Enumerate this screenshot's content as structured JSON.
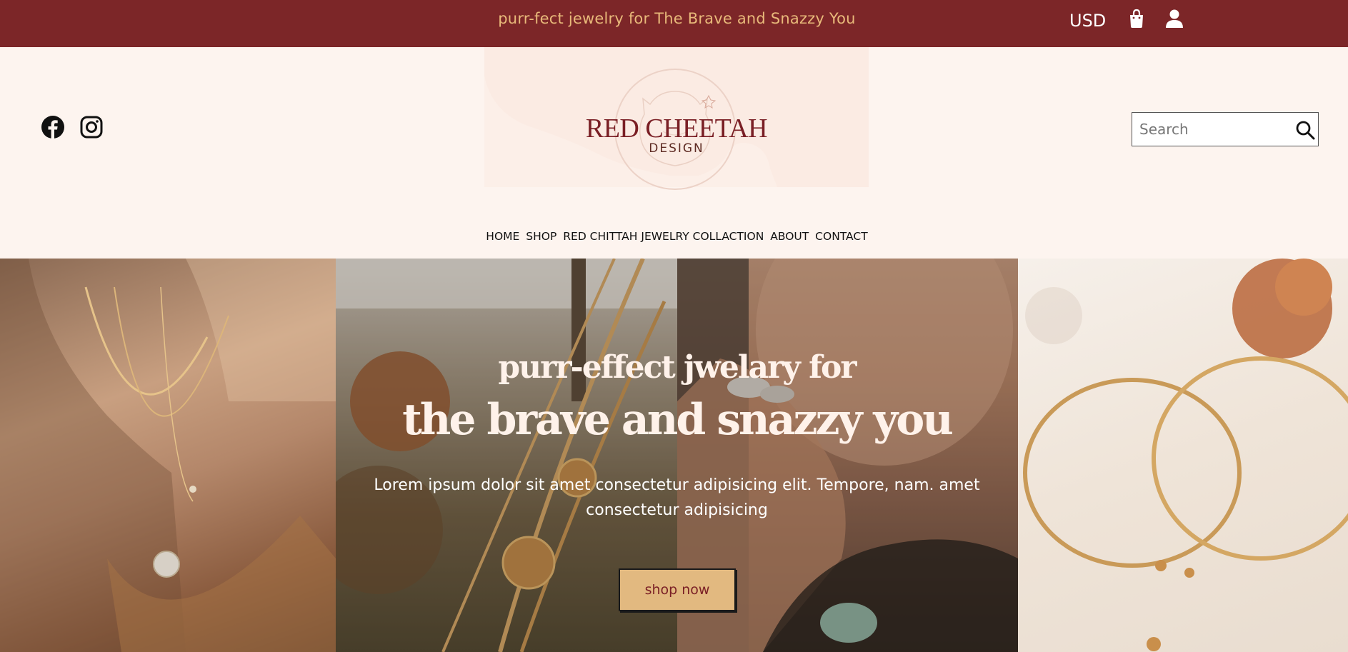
{
  "topbar": {
    "promo": "purr-fect jewelry for The Brave and Snazzy You",
    "currency": "USD",
    "bag_icon": "shopping-bag-icon",
    "user_icon": "user-icon"
  },
  "header": {
    "logo_title": "RED CHEETAH",
    "logo_subtitle": "DESIGN",
    "social": [
      "facebook-icon",
      "instagram-icon"
    ],
    "search": {
      "placeholder": "Search",
      "icon": "search-icon"
    }
  },
  "nav": {
    "items": [
      {
        "label": "HOME"
      },
      {
        "label": "SHOP"
      },
      {
        "label": "RED CHITTAH JEWELRY COLLACTION"
      },
      {
        "label": "ABOUT"
      },
      {
        "label": "CONTACT"
      }
    ]
  },
  "hero": {
    "heading_line1": "purr-effect jwelary for",
    "heading_line2": "the brave and snazzy you",
    "body": "Lorem ipsum dolor sit amet consectetur adipisicing elit. Tempore, nam. amet consectetur adipisicing",
    "cta": "shop now"
  },
  "colors": {
    "brand": "#7c2628",
    "accent": "#e2b980",
    "background": "#fdf4ef"
  }
}
